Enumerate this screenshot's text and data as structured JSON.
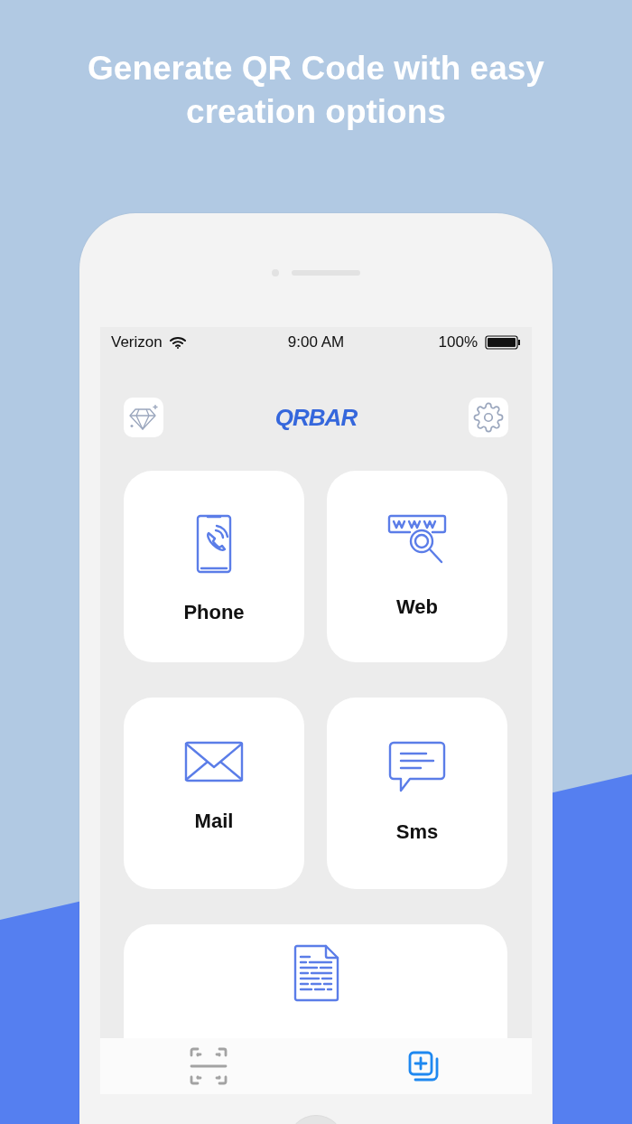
{
  "headline": "Generate QR Code with easy creation options",
  "status_bar": {
    "carrier": "Verizon",
    "time": "9:00 AM",
    "battery": "100%"
  },
  "header": {
    "logo": "QRBAR"
  },
  "cards": [
    {
      "kind": "phone",
      "label": "Phone"
    },
    {
      "kind": "web",
      "label": "Web"
    },
    {
      "kind": "mail",
      "label": "Mail"
    },
    {
      "kind": "sms",
      "label": "Sms"
    },
    {
      "kind": "text"
    }
  ],
  "tabs": [
    {
      "kind": "scan",
      "selected": false
    },
    {
      "kind": "create",
      "selected": true
    }
  ]
}
